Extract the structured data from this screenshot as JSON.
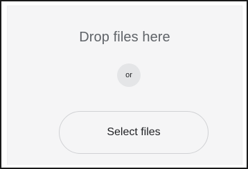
{
  "drop_zone": {
    "message": "Drop files here",
    "separator": "or",
    "button_label": "Select files"
  },
  "colors": {
    "zone_background": "#f5f5f6",
    "badge_background": "#e4e5e7",
    "message_text": "#5f6368",
    "button_border": "#d0d1d4"
  }
}
